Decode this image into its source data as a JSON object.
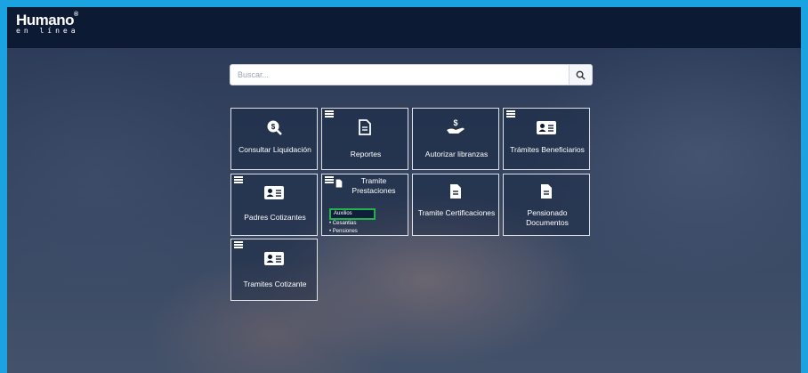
{
  "brand": {
    "name": "Humano",
    "registered": "®",
    "tagline": "en línea"
  },
  "search": {
    "placeholder": "Buscar..."
  },
  "tiles": [
    {
      "label": "Consultar Liquidación",
      "icon": "dollar-search-icon",
      "has_menu": false
    },
    {
      "label": "Reportes",
      "icon": "document-icon",
      "has_menu": true
    },
    {
      "label": "Autorizar libranzas",
      "icon": "hand-money-icon",
      "has_menu": false
    },
    {
      "label": "Trámites Beneficiarios",
      "icon": "id-card-icon",
      "has_menu": true
    },
    {
      "label": "Padres Cotizantes",
      "icon": "id-card-icon",
      "has_menu": true
    },
    {
      "label": "Tramite Prestaciones",
      "icon": "document-icon",
      "has_menu": true,
      "subitems": [
        "Auxilios",
        "Cesantias",
        "Pensiones"
      ],
      "selected_subitem": "Auxilios"
    },
    {
      "label": "Tramite Certificaciones",
      "icon": "document-icon",
      "has_menu": false
    },
    {
      "label": "Pensionado Documentos",
      "icon": "document-icon",
      "has_menu": false
    },
    {
      "label": "Tramites Cotizante",
      "icon": "id-card-icon",
      "has_menu": true
    }
  ],
  "colors": {
    "accent": "#1aa3e0",
    "topbar": "#0d1a33",
    "highlight": "#22b24c"
  }
}
